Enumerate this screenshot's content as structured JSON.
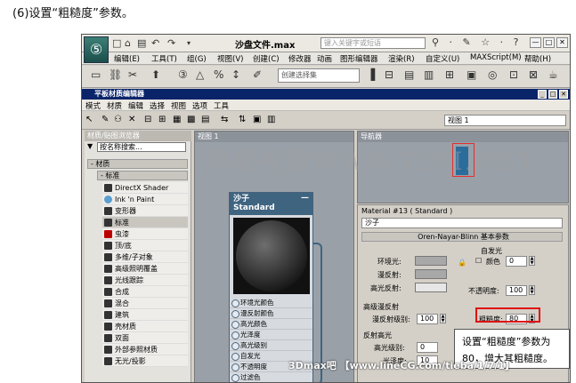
{
  "caption": "(6)设置“粗糙度”参数。",
  "window": {
    "title": "沙盘文件.max",
    "search_placeholder": "键入关键字或短语",
    "title_icons": "⚲ · ✎ ☆ · ?",
    "controls": {
      "minimize": "—",
      "maximize": "□",
      "close": "✕"
    }
  },
  "menu": [
    "编辑(E)",
    "工具(T)",
    "组(G)",
    "视图(V)",
    "创建(C)",
    "修改器",
    "动画",
    "图形编辑器",
    "渲染(R)",
    "自定义(U)",
    "MAXScript(M)",
    "帮助(H)"
  ],
  "toolbar": {
    "selection_set": "创建选择集"
  },
  "sme": {
    "title": "平板材质编辑器",
    "menu": [
      "模式",
      "材质",
      "编辑",
      "选择",
      "视图",
      "选项",
      "工具"
    ],
    "view_select": "视图 1"
  },
  "browser": {
    "title": "材质/贴图浏览器",
    "search": "按名称搜索...",
    "group": "- 材质",
    "subgroup": "- 标准",
    "items": [
      "DirectX Shader",
      "Ink 'n Paint",
      "变形器",
      "标准",
      "虫漆",
      "顶/底",
      "多维/子对象",
      "高级照明覆盖",
      "光线跟踪",
      "合成",
      "混合",
      "建筑",
      "壳材质",
      "双面",
      "外部参照材质",
      "无光/投影"
    ]
  },
  "view": {
    "tab": "视图 1",
    "node": {
      "name": "沙子",
      "type": "Standard",
      "slots": [
        "环境光颜色",
        "漫反射颜色",
        "高光颜色",
        "光泽度",
        "高光级别",
        "自发光",
        "不透明度",
        "过滤色"
      ]
    }
  },
  "navigator": {
    "title": "导航器"
  },
  "props": {
    "title": "Material #13 ( Standard )",
    "name": "沙子",
    "rollout": "Oren-Nayar-Blinn 基本参数",
    "self_illum": "自发光",
    "color_label": "颜色",
    "color_value": "0",
    "ambient": "环境光:",
    "diffuse": "漫反射:",
    "specular": "高光反射:",
    "opacity": "不透明度:",
    "opacity_value": "100",
    "adv_diffuse": "高级漫反射",
    "diffuse_level": "漫反射级别:",
    "diffuse_level_value": "100",
    "roughness": "粗糙度:",
    "roughness_value": "80",
    "spec_highlights": "反射高光",
    "spec_level": "高光级别:",
    "spec_level_value": "0",
    "glossiness": "光泽度:",
    "glossiness_value": "10"
  },
  "callout": "设置“粗糙度”参数为 80，增大其粗糙度。",
  "watermark": "腾龍視覺WWW.TLVI.NET",
  "footer": "3Dmax吧 【www.lineCG.com/tieba/1/7/1】"
}
